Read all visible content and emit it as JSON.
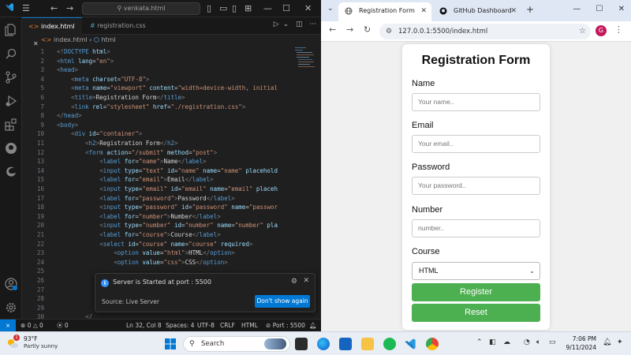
{
  "vscode": {
    "search_text": "venkata.html",
    "tabs": [
      {
        "label": "index.html",
        "active": true
      },
      {
        "label": "registration.css",
        "active": false
      }
    ],
    "breadcrumb": [
      "index.html",
      "html"
    ],
    "lines": [
      {
        "n": "1",
        "html": "<span class='t-br'>&lt;!</span><span class='t-tag'>DOCTYPE</span> <span class='t-attr'>html</span><span class='t-br'>&gt;</span>"
      },
      {
        "n": "2",
        "html": "<span class='t-br'>&lt;</span><span class='t-tag'>html</span> <span class='t-attr'>lang</span>=<span class='t-str'>\"en\"</span><span class='t-br'>&gt;</span>"
      },
      {
        "n": "3",
        "html": "<span class='t-br'>&lt;</span><span class='t-tag'>head</span><span class='t-br'>&gt;</span>"
      },
      {
        "n": "4",
        "html": "    <span class='t-br'>&lt;</span><span class='t-tag'>meta</span> <span class='t-attr'>charset</span>=<span class='t-str'>\"UTF-8\"</span><span class='t-br'>&gt;</span>"
      },
      {
        "n": "5",
        "html": "    <span class='t-br'>&lt;</span><span class='t-tag'>meta</span> <span class='t-attr'>name</span>=<span class='t-str'>\"viewport\"</span> <span class='t-attr'>content</span>=<span class='t-str'>\"width=device-width, initial</span>"
      },
      {
        "n": "6",
        "html": "    <span class='t-br'>&lt;</span><span class='t-tag'>title</span><span class='t-br'>&gt;</span><span class='t-txt'>Registration Form</span><span class='t-br'>&lt;/</span><span class='t-tag'>title</span><span class='t-br'>&gt;</span>"
      },
      {
        "n": "7",
        "html": "    <span class='t-br'>&lt;</span><span class='t-tag'>link</span> <span class='t-attr'>rel</span>=<span class='t-str'>\"stylesheet\"</span> <span class='t-attr'>href</span>=<span class='t-str'>\"./registration.css\"</span><span class='t-br'>&gt;</span>"
      },
      {
        "n": "8",
        "html": "<span class='t-br'>&lt;/</span><span class='t-tag'>head</span><span class='t-br'>&gt;</span>"
      },
      {
        "n": "9",
        "html": "<span class='t-br'>&lt;</span><span class='t-tag'>body</span><span class='t-br'>&gt;</span>"
      },
      {
        "n": "10",
        "html": "    <span class='t-br'>&lt;</span><span class='t-tag'>div</span> <span class='t-attr'>id</span>=<span class='t-str'>\"container\"</span><span class='t-br'>&gt;</span>"
      },
      {
        "n": "11",
        "html": "        <span class='t-br'>&lt;</span><span class='t-tag'>h2</span><span class='t-br'>&gt;</span><span class='t-txt'>Registration Form</span><span class='t-br'>&lt;/</span><span class='t-tag'>h2</span><span class='t-br'>&gt;</span>"
      },
      {
        "n": "12",
        "html": "        <span class='t-br'>&lt;</span><span class='t-tag'>form</span> <span class='t-attr'>action</span>=<span class='t-str'>\"/submit\"</span> <span class='t-attr'>method</span>=<span class='t-str'>\"post\"</span><span class='t-br'>&gt;</span>"
      },
      {
        "n": "13",
        "html": "            <span class='t-br'>&lt;</span><span class='t-tag'>label</span> <span class='t-attr'>for</span>=<span class='t-str'>\"name\"</span><span class='t-br'>&gt;</span><span class='t-txt'>Name</span><span class='t-br'>&lt;/</span><span class='t-tag'>label</span><span class='t-br'>&gt;</span>"
      },
      {
        "n": "14",
        "html": "            <span class='t-br'>&lt;</span><span class='t-tag'>input</span> <span class='t-attr'>type</span>=<span class='t-str'>\"text\"</span> <span class='t-attr'>id</span>=<span class='t-str'>\"name\"</span> <span class='t-attr'>name</span>=<span class='t-str'>\"name\"</span> <span class='t-attr'>placehold</span>"
      },
      {
        "n": "15",
        "html": "            <span class='t-br'>&lt;</span><span class='t-tag'>label</span> <span class='t-attr'>for</span>=<span class='t-str'>\"email\"</span><span class='t-br'>&gt;</span><span class='t-txt'>Email</span><span class='t-br'>&lt;/</span><span class='t-tag'>label</span><span class='t-br'>&gt;</span>"
      },
      {
        "n": "16",
        "html": "            <span class='t-br'>&lt;</span><span class='t-tag'>input</span> <span class='t-attr'>type</span>=<span class='t-str'>\"email\"</span> <span class='t-attr'>id</span>=<span class='t-str'>\"email\"</span> <span class='t-attr'>name</span>=<span class='t-str'>\"email\"</span> <span class='t-attr'>placeh</span>"
      },
      {
        "n": "17",
        "html": "            <span class='t-br'>&lt;</span><span class='t-tag'>label</span> <span class='t-attr'>for</span>=<span class='t-str'>\"password\"</span><span class='t-br'>&gt;</span><span class='t-txt'>Password</span><span class='t-br'>&lt;/</span><span class='t-tag'>label</span><span class='t-br'>&gt;</span>"
      },
      {
        "n": "18",
        "html": "            <span class='t-br'>&lt;</span><span class='t-tag'>input</span> <span class='t-attr'>type</span>=<span class='t-str'>\"password\"</span> <span class='t-attr'>id</span>=<span class='t-str'>\"password\"</span> <span class='t-attr'>name</span>=<span class='t-str'>\"passwor</span>"
      },
      {
        "n": "19",
        "html": "            <span class='t-br'>&lt;</span><span class='t-tag'>label</span> <span class='t-attr'>for</span>=<span class='t-str'>\"number\"</span><span class='t-br'>&gt;</span><span class='t-txt'>Number</span><span class='t-br'>&lt;/</span><span class='t-tag'>label</span><span class='t-br'>&gt;</span>"
      },
      {
        "n": "20",
        "html": "            <span class='t-br'>&lt;</span><span class='t-tag'>input</span> <span class='t-attr'>type</span>=<span class='t-str'>\"number\"</span> <span class='t-attr'>id</span>=<span class='t-str'>\"number\"</span> <span class='t-attr'>name</span>=<span class='t-str'>\"number\"</span> <span class='t-attr'>pla</span>"
      },
      {
        "n": "21",
        "html": "            <span class='t-br'>&lt;</span><span class='t-tag'>label</span> <span class='t-attr'>for</span>=<span class='t-str'>\"course\"</span><span class='t-br'>&gt;</span><span class='t-txt'>Course</span><span class='t-br'>&lt;/</span><span class='t-tag'>label</span><span class='t-br'>&gt;</span>"
      },
      {
        "n": "22",
        "html": "            <span class='t-br'>&lt;</span><span class='t-tag'>select</span> <span class='t-attr'>id</span>=<span class='t-str'>\"course\"</span> <span class='t-attr'>name</span>=<span class='t-str'>\"course\"</span> <span class='t-attr'>required</span><span class='t-br'>&gt;</span>"
      },
      {
        "n": "23",
        "html": "                <span class='t-br'>&lt;</span><span class='t-tag'>option</span> <span class='t-attr'>value</span>=<span class='t-str'>\"html\"</span><span class='t-br'>&gt;</span><span class='t-txt'>HTML</span><span class='t-br'>&lt;/</span><span class='t-tag'>option</span><span class='t-br'>&gt;</span>"
      },
      {
        "n": "24",
        "html": "                <span class='t-br'>&lt;</span><span class='t-tag'>option</span> <span class='t-attr'>value</span>=<span class='t-str'>\"css\"</span><span class='t-br'>&gt;</span><span class='t-txt'>CSS</span><span class='t-br'>&lt;/</span><span class='t-tag'>option</span><span class='t-br'>&gt;</span>"
      },
      {
        "n": "25",
        "html": ""
      },
      {
        "n": "26",
        "html": ""
      },
      {
        "n": "27",
        "html": ""
      },
      {
        "n": "28",
        "html": ""
      },
      {
        "n": "29",
        "html": ""
      },
      {
        "n": "30",
        "html": "        <span class='t-br'>&lt;/</span>"
      }
    ],
    "toast": {
      "message": "Server is Started at port : 5500",
      "source": "Source: Live Server",
      "button": "Don't show again"
    },
    "status": {
      "errors": "0",
      "warnings": "0",
      "ports": "0",
      "position": "Ln 32, Col 8",
      "spaces": "Spaces: 4",
      "encoding": "UTF-8",
      "eol": "CRLF",
      "language": "HTML",
      "port": "Port : 5500"
    }
  },
  "chrome": {
    "tabs": [
      {
        "label": "Registration Form",
        "active": true
      },
      {
        "label": "GitHub Dashboard",
        "active": false
      }
    ],
    "url": "127.0.0.1:5500/index.html",
    "avatar_letter": "G"
  },
  "form": {
    "title": "Registration Form",
    "name_label": "Name",
    "name_placeholder": "Your name..",
    "email_label": "Email",
    "email_placeholder": "Your email..",
    "password_label": "Password",
    "password_placeholder": "Your password..",
    "number_label": "Number",
    "number_placeholder": "number..",
    "course_label": "Course",
    "course_selected": "HTML",
    "register_label": "Register",
    "reset_label": "Reset",
    "button_color": "#4caf50"
  },
  "taskbar": {
    "weather_temp": "93°F",
    "weather_cond": "Partly sunny",
    "weather_badge": "1",
    "search_text": "Search",
    "time": "7:06 PM",
    "date": "9/11/2024"
  }
}
